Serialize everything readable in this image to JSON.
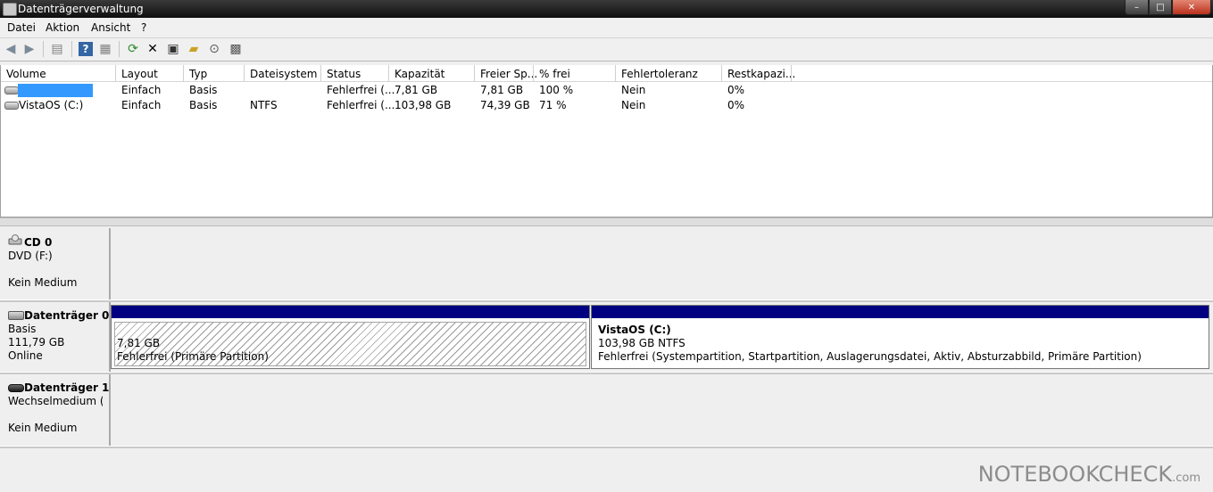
{
  "window": {
    "title": "Datenträgerverwaltung",
    "min_glyph": "–",
    "max_glyph": "□",
    "close_glyph": "✕"
  },
  "menu": [
    "Datei",
    "Aktion",
    "Ansicht",
    "?"
  ],
  "toolbar_icons": [
    "back-arrow-icon",
    "forward-arrow-icon",
    "console-tree-icon",
    "help-icon",
    "show-hide-icon",
    "refresh-icon",
    "delete-icon",
    "properties-icon",
    "open-icon",
    "explore-icon",
    "export-icon"
  ],
  "volume_list": {
    "columns": [
      "Volume",
      "Layout",
      "Typ",
      "Dateisystem",
      "Status",
      "Kapazität",
      "Freier Sp...",
      "% frei",
      "Fehlertoleranz",
      "Restkapazi..."
    ],
    "rows": [
      {
        "volume": "",
        "layout": "Einfach",
        "typ": "Basis",
        "fs": "",
        "status": "Fehlerfrei (...",
        "capacity": "7,81 GB",
        "free": "7,81 GB",
        "pct": "100 %",
        "fault": "Nein",
        "rest": "0%"
      },
      {
        "volume": "VistaOS (C:)",
        "layout": "Einfach",
        "typ": "Basis",
        "fs": "NTFS",
        "status": "Fehlerfrei (...",
        "capacity": "103,98 GB",
        "free": "74,39 GB",
        "pct": "71 %",
        "fault": "Nein",
        "rest": "0%"
      }
    ]
  },
  "disks": {
    "cd0": {
      "name": "CD 0",
      "line1": "DVD (F:)",
      "line2": "Kein Medium"
    },
    "disk0": {
      "name": "Datenträger 0",
      "type": "Basis",
      "size": "111,79 GB",
      "state": "Online",
      "p1": {
        "size": "7,81 GB",
        "status": "Fehlerfrei (Primäre Partition)"
      },
      "p2": {
        "name": "VistaOS  (C:)",
        "size": "103,98 GB NTFS",
        "status": "Fehlerfrei (Systempartition, Startpartition, Auslagerungsdatei, Aktiv, Absturzabbild, Primäre Partition)"
      }
    },
    "disk1": {
      "name": "Datenträger 1",
      "line1": "Wechselmedium (E:",
      "line2": "Kein Medium"
    }
  },
  "watermark": {
    "main": "NOTEBOOKCHECK",
    "suffix": ".com"
  }
}
